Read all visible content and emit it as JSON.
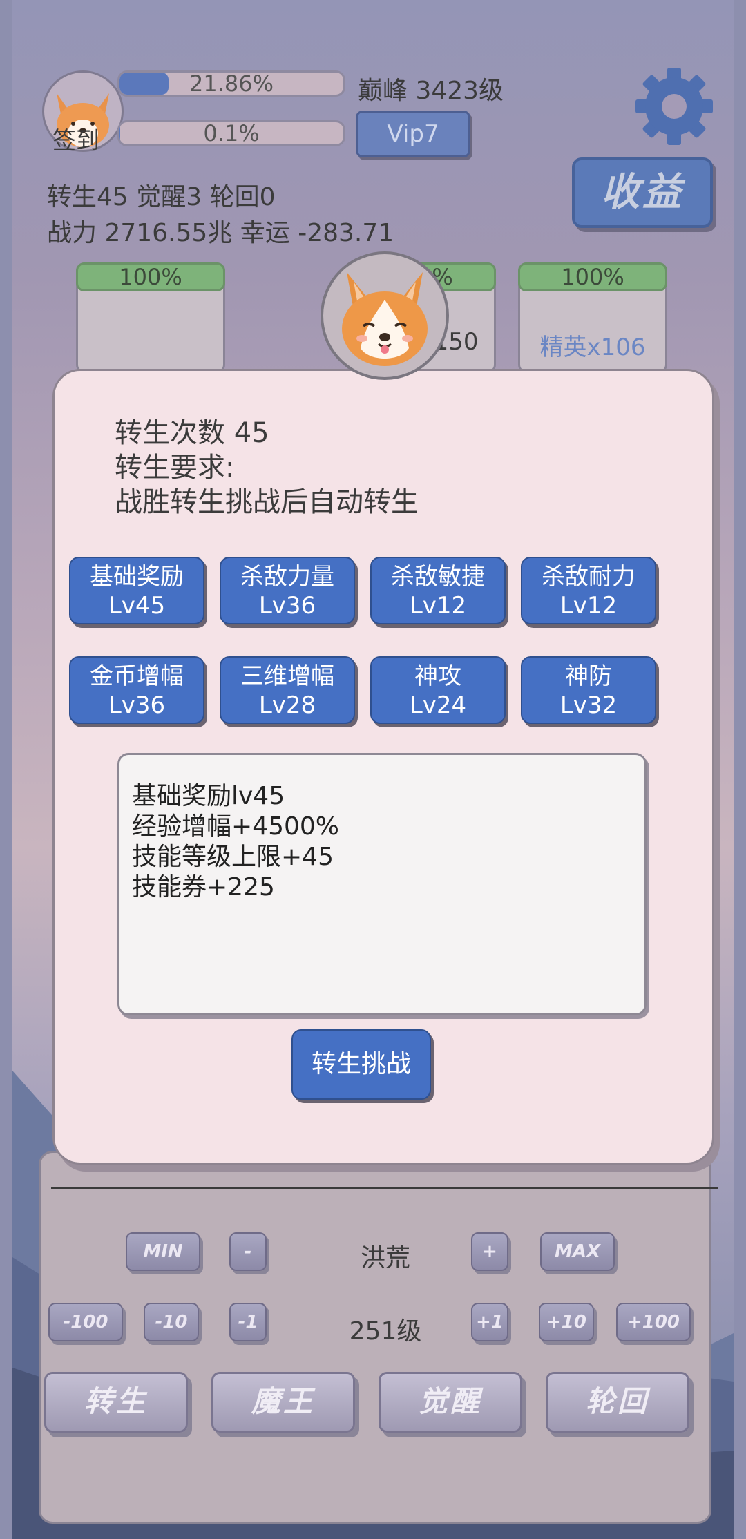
{
  "header": {
    "sign_in_label": "签到",
    "exp_bar": {
      "text": "21.86%",
      "fraction": 0.2186
    },
    "second_bar": {
      "text": "0.1%",
      "fraction": 0.001
    },
    "peak_level": "巅峰 3423级",
    "vip_label": "Vip7",
    "income_label": "收益",
    "stats_line1": "转生45 觉醒3 轮回0",
    "stats_line2": "战力 2716.55兆  幸运 -283.71"
  },
  "cards": [
    {
      "pct": "100%",
      "label": ""
    },
    {
      "pct": "100%",
      "label": "x150"
    },
    {
      "pct": "100%",
      "label": "精英x106"
    }
  ],
  "modal": {
    "count_line": "转生次数 45",
    "req_line": "转生要求:",
    "req_detail": "战胜转生挑战后自动转生",
    "skills": [
      {
        "name": "基础奖励",
        "level": "Lv45"
      },
      {
        "name": "杀敌力量",
        "level": "Lv36"
      },
      {
        "name": "杀敌敏捷",
        "level": "Lv12"
      },
      {
        "name": "杀敌耐力",
        "level": "Lv12"
      },
      {
        "name": "金币增幅",
        "level": "Lv36"
      },
      {
        "name": "三维增幅",
        "level": "Lv28"
      },
      {
        "name": "神攻",
        "level": "Lv24"
      },
      {
        "name": "神防",
        "level": "Lv32"
      }
    ],
    "info_lines": [
      "基础奖励lv45",
      "经验增幅+4500%",
      "技能等级上限+45",
      "技能券+225"
    ],
    "challenge_label": "转生挑战"
  },
  "selector": {
    "min_label": "MIN",
    "minus_label": "-",
    "region_name": "洪荒",
    "plus_label": "+",
    "max_label": "MAX",
    "minus100": "-100",
    "minus10": "-10",
    "minus1": "-1",
    "level_label": "251级",
    "plus1": "+1",
    "plus10": "+10",
    "plus100": "+100"
  },
  "bottom_tabs": [
    "转生",
    "魔王",
    "觉醒",
    "轮回"
  ],
  "colors": {
    "accent": "#4570c4",
    "modal_bg": "#f5e3e7",
    "progress_green": "#7eb37a"
  }
}
